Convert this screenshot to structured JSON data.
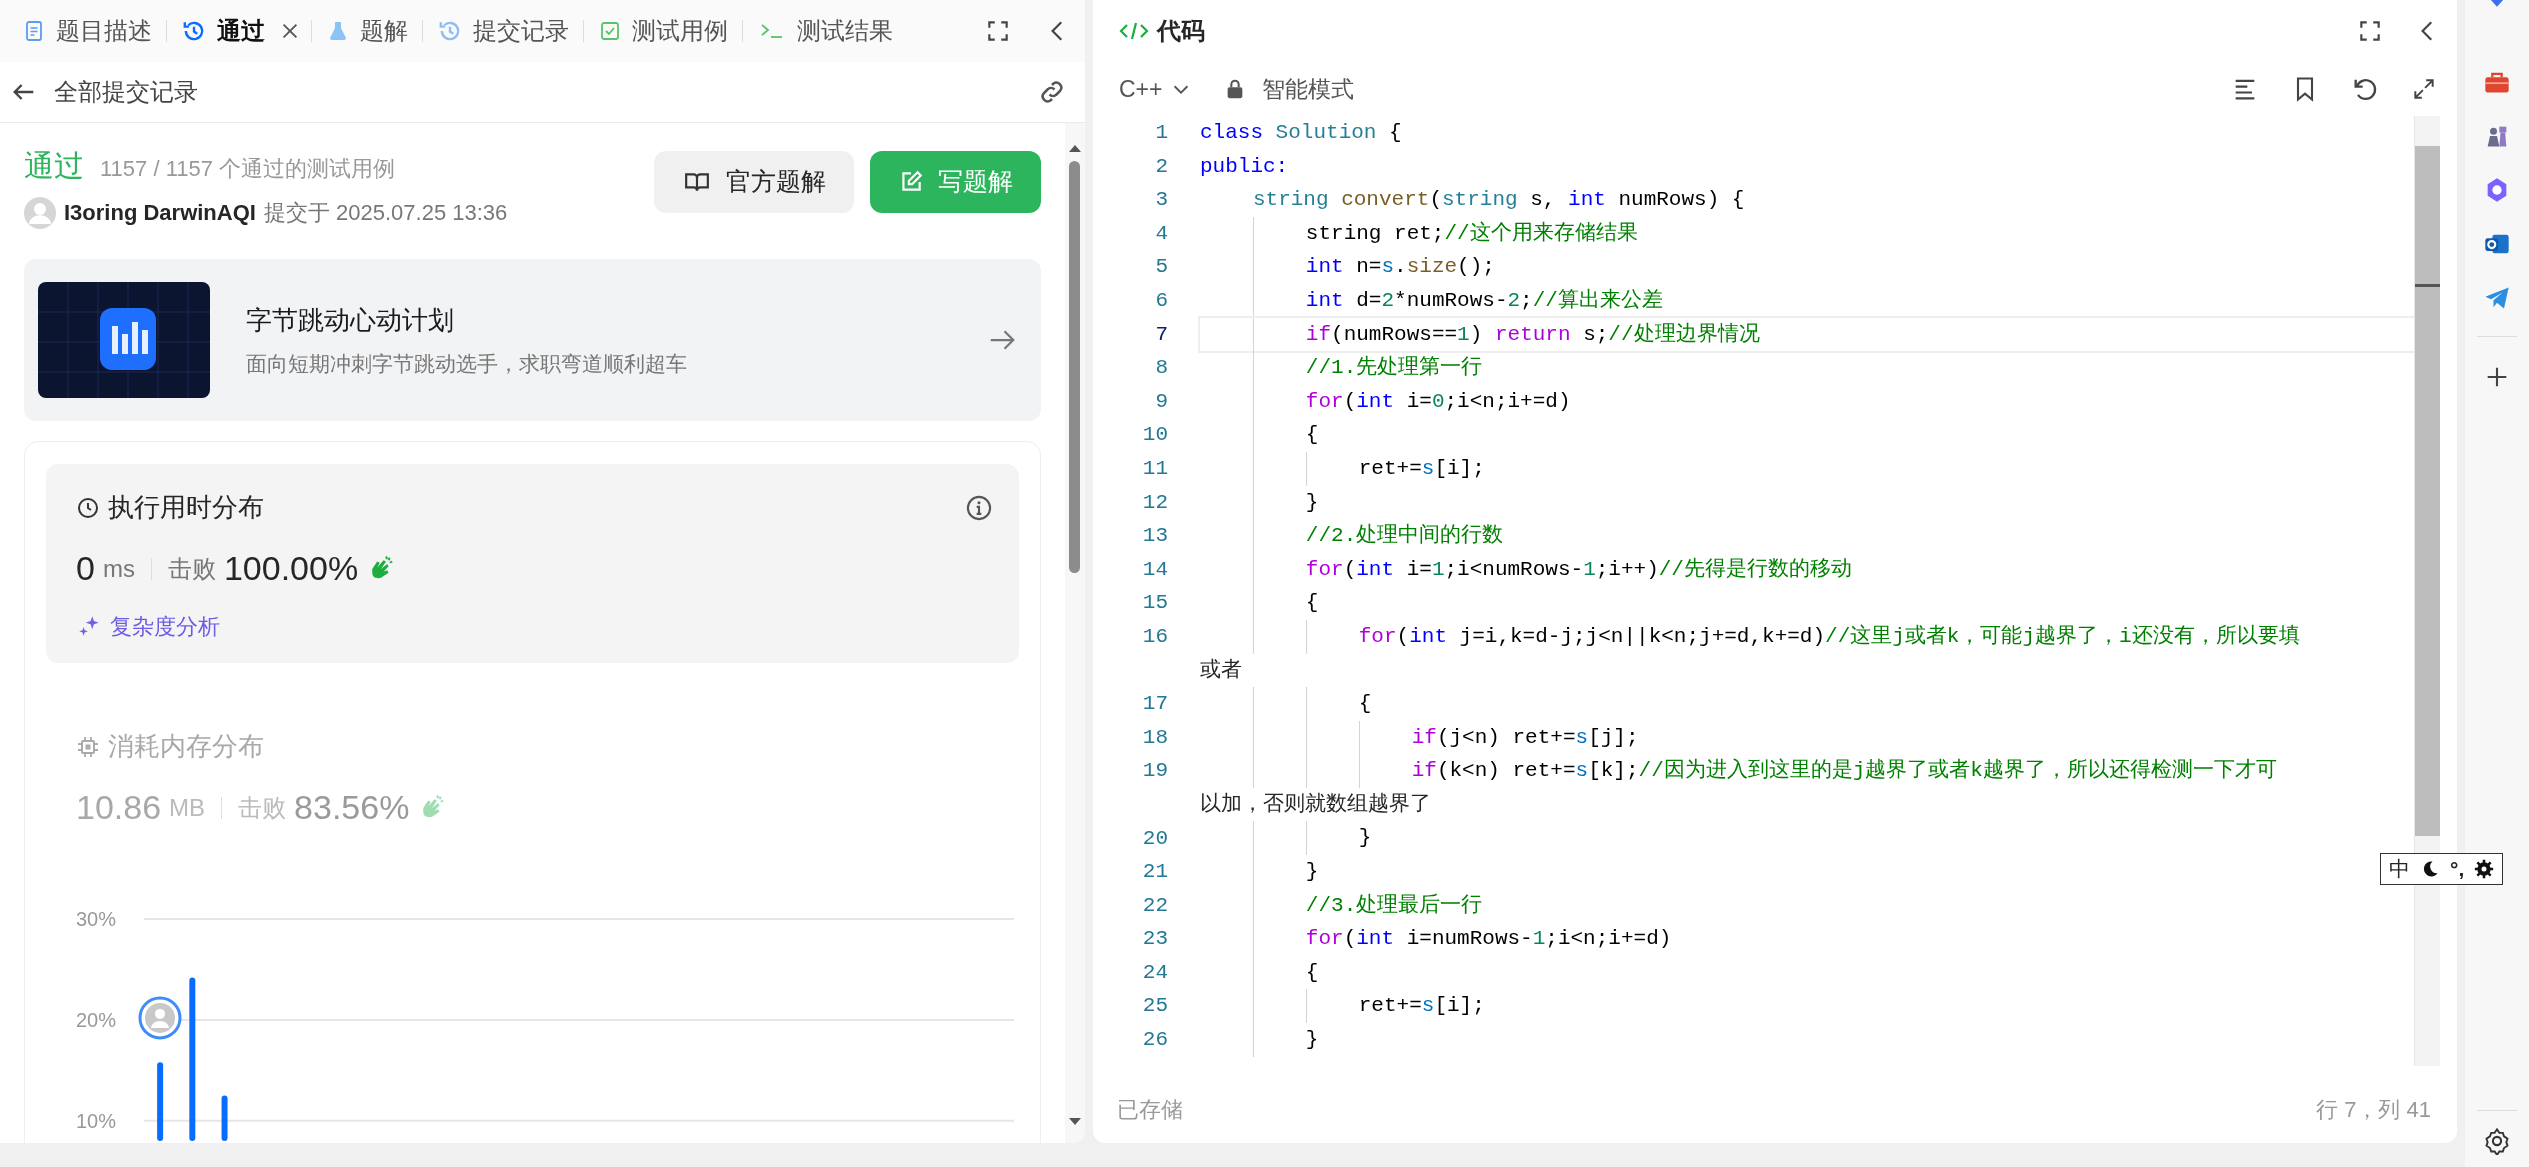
{
  "left_tabs": [
    {
      "label": "题目描述",
      "selected": false,
      "closable": false
    },
    {
      "label": "通过",
      "selected": true,
      "closable": true
    },
    {
      "label": "题解",
      "selected": false,
      "closable": false
    },
    {
      "label": "提交记录",
      "selected": false,
      "closable": false
    },
    {
      "label": "测试用例",
      "selected": false,
      "closable": false
    },
    {
      "label": "测试结果",
      "selected": false,
      "closable": false
    }
  ],
  "back_link": "全部提交记录",
  "result": {
    "status": "通过",
    "cases": "1157 / 1157 个通过的测试用例",
    "user": "I3oring DarwinAQI",
    "submitted": "提交于 2025.07.25 13:36"
  },
  "buttons": [
    {
      "label": "官方题解",
      "kind": "secondary"
    },
    {
      "label": "写题解",
      "kind": "primary"
    }
  ],
  "banner": {
    "title": "字节跳动心动计划",
    "subtitle": "面向短期冲刺字节跳动选手，求职弯道顺利超车"
  },
  "metrics": [
    {
      "title": "执行用时分布",
      "value": "0",
      "unit": "ms",
      "beats_label": "击败",
      "beats": "100.00%",
      "selected": true,
      "link": "复杂度分析"
    },
    {
      "title": "消耗内存分布",
      "value": "10.86",
      "unit": "MB",
      "beats_label": "击败",
      "beats": "83.56%",
      "selected": false
    }
  ],
  "chart_data": {
    "type": "bar",
    "values": [
      15.8,
      24.2,
      12.5,
      null,
      null,
      null,
      null,
      null,
      null,
      null,
      null,
      null,
      null,
      null,
      null,
      null,
      null,
      null,
      null,
      null,
      null,
      null,
      null,
      null,
      null,
      null,
      null
    ],
    "ylim": [
      8,
      30
    ],
    "yticks": [
      {
        "value": 10,
        "label": "10%"
      },
      {
        "value": 20,
        "label": "20%"
      },
      {
        "value": 30,
        "label": "30%"
      }
    ]
  },
  "editor": {
    "title": "代码",
    "language": "C++",
    "mode": "智能模式",
    "lines": [
      {
        "number": "1",
        "current": false,
        "tokens": [
          {
            "kind": "keyword",
            "text": "class"
          },
          {
            "kind": "type",
            "text": " Solution"
          },
          {
            "kind": "plain",
            "text": " {"
          }
        ]
      },
      {
        "number": "2",
        "current": false,
        "tokens": [
          {
            "kind": "keyword",
            "text": "public:"
          }
        ]
      },
      {
        "number": "3",
        "current": false,
        "tokens": [
          {
            "kind": "type",
            "text": "    string"
          },
          {
            "kind": "function",
            "text": " convert"
          },
          {
            "kind": "plain",
            "text": "("
          },
          {
            "kind": "type",
            "text": "string"
          },
          {
            "kind": "plain",
            "text": " s, "
          },
          {
            "kind": "keyword",
            "text": "int"
          },
          {
            "kind": "plain",
            "text": " numRows) {"
          }
        ]
      },
      {
        "number": "4",
        "current": false,
        "tokens": [
          {
            "kind": "plain",
            "text": "        string ret;"
          },
          {
            "kind": "comment",
            "text": "//这个用来存储结果"
          }
        ]
      },
      {
        "number": "5",
        "current": false,
        "tokens": [
          {
            "kind": "keyword",
            "text": "        int"
          },
          {
            "kind": "plain",
            "text": " n="
          },
          {
            "kind": "variable",
            "text": "s"
          },
          {
            "kind": "plain",
            "text": "."
          },
          {
            "kind": "function",
            "text": "size"
          },
          {
            "kind": "plain",
            "text": "();"
          }
        ]
      },
      {
        "number": "6",
        "current": false,
        "tokens": [
          {
            "kind": "keyword",
            "text": "        int"
          },
          {
            "kind": "plain",
            "text": " d="
          },
          {
            "kind": "number",
            "text": "2"
          },
          {
            "kind": "plain",
            "text": "*numRows-"
          },
          {
            "kind": "number",
            "text": "2"
          },
          {
            "kind": "plain",
            "text": ";"
          },
          {
            "kind": "comment",
            "text": "//算出来公差"
          }
        ]
      },
      {
        "number": "7",
        "current": true,
        "tokens": [
          {
            "kind": "control",
            "text": "        if"
          },
          {
            "kind": "plain",
            "text": "(numRows=="
          },
          {
            "kind": "number",
            "text": "1"
          },
          {
            "kind": "plain",
            "text": ") "
          },
          {
            "kind": "control",
            "text": "return"
          },
          {
            "kind": "plain",
            "text": " s;"
          },
          {
            "kind": "comment",
            "text": "//处理边界情况"
          }
        ]
      },
      {
        "number": "8",
        "current": false,
        "tokens": [
          {
            "kind": "comment",
            "text": "        //1.先处理第一行"
          }
        ]
      },
      {
        "number": "9",
        "current": false,
        "tokens": [
          {
            "kind": "control",
            "text": "        for"
          },
          {
            "kind": "plain",
            "text": "("
          },
          {
            "kind": "keyword",
            "text": "int"
          },
          {
            "kind": "plain",
            "text": " i="
          },
          {
            "kind": "number",
            "text": "0"
          },
          {
            "kind": "plain",
            "text": ";i<n;i+=d)"
          }
        ]
      },
      {
        "number": "10",
        "current": false,
        "tokens": [
          {
            "kind": "plain",
            "text": "        {"
          }
        ]
      },
      {
        "number": "11",
        "current": false,
        "tokens": [
          {
            "kind": "plain",
            "text": "            ret+="
          },
          {
            "kind": "variable",
            "text": "s"
          },
          {
            "kind": "plain",
            "text": "[i];"
          }
        ]
      },
      {
        "number": "12",
        "current": false,
        "tokens": [
          {
            "kind": "plain",
            "text": "        }"
          }
        ]
      },
      {
        "number": "13",
        "current": false,
        "tokens": [
          {
            "kind": "comment",
            "text": "        //2.处理中间的行数"
          }
        ]
      },
      {
        "number": "14",
        "current": false,
        "tokens": [
          {
            "kind": "control",
            "text": "        for"
          },
          {
            "kind": "plain",
            "text": "("
          },
          {
            "kind": "keyword",
            "text": "int"
          },
          {
            "kind": "plain",
            "text": " i="
          },
          {
            "kind": "number",
            "text": "1"
          },
          {
            "kind": "plain",
            "text": ";i<numRows-"
          },
          {
            "kind": "number",
            "text": "1"
          },
          {
            "kind": "plain",
            "text": ";i++)"
          },
          {
            "kind": "comment",
            "text": "//先得是行数的移动"
          }
        ]
      },
      {
        "number": "15",
        "current": false,
        "tokens": [
          {
            "kind": "plain",
            "text": "        {"
          }
        ]
      },
      {
        "number": "16",
        "current": false,
        "tokens": [
          {
            "kind": "control",
            "text": "            for"
          },
          {
            "kind": "plain",
            "text": "("
          },
          {
            "kind": "keyword",
            "text": "int"
          },
          {
            "kind": "plain",
            "text": " j=i,k=d-j;j<n||k<n;j+=d,k+=d)"
          },
          {
            "kind": "comment",
            "text": "//这里j或者k，可能j越界了，i还没有，所以要填"
          }
        ],
        "continuation": "或者"
      },
      {
        "number": "17",
        "current": false,
        "tokens": [
          {
            "kind": "plain",
            "text": "            {"
          }
        ]
      },
      {
        "number": "18",
        "current": false,
        "tokens": [
          {
            "kind": "control",
            "text": "                if"
          },
          {
            "kind": "plain",
            "text": "(j<n) ret+="
          },
          {
            "kind": "variable",
            "text": "s"
          },
          {
            "kind": "plain",
            "text": "[j];"
          }
        ]
      },
      {
        "number": "19",
        "current": false,
        "tokens": [
          {
            "kind": "control",
            "text": "                if"
          },
          {
            "kind": "plain",
            "text": "(k<n) ret+="
          },
          {
            "kind": "variable",
            "text": "s"
          },
          {
            "kind": "plain",
            "text": "[k];"
          },
          {
            "kind": "comment",
            "text": "//因为进入到这里的是j越界了或者k越界了，所以还得检测一下才可"
          }
        ],
        "continuation": "以加，否则就数组越界了"
      },
      {
        "number": "20",
        "current": false,
        "tokens": [
          {
            "kind": "plain",
            "text": "            }"
          }
        ]
      },
      {
        "number": "21",
        "current": false,
        "tokens": [
          {
            "kind": "plain",
            "text": "        }"
          }
        ]
      },
      {
        "number": "22",
        "current": false,
        "tokens": [
          {
            "kind": "comment",
            "text": "        //3.处理最后一行"
          }
        ]
      },
      {
        "number": "23",
        "current": false,
        "tokens": [
          {
            "kind": "control",
            "text": "        for"
          },
          {
            "kind": "plain",
            "text": "("
          },
          {
            "kind": "keyword",
            "text": "int"
          },
          {
            "kind": "plain",
            "text": " i=numRows-"
          },
          {
            "kind": "number",
            "text": "1"
          },
          {
            "kind": "plain",
            "text": ";i<n;i+=d)"
          }
        ]
      },
      {
        "number": "24",
        "current": false,
        "tokens": [
          {
            "kind": "plain",
            "text": "        {"
          }
        ]
      },
      {
        "number": "25",
        "current": false,
        "tokens": [
          {
            "kind": "plain",
            "text": "            ret+="
          },
          {
            "kind": "variable",
            "text": "s"
          },
          {
            "kind": "plain",
            "text": "[i];"
          }
        ]
      },
      {
        "number": "26",
        "current": false,
        "tokens": [
          {
            "kind": "plain",
            "text": "        }"
          }
        ]
      }
    ]
  },
  "status_bar": {
    "saved": "已存储",
    "position": "行 7，列 41"
  },
  "ime_toolbar": {
    "mode": "中",
    "punctuation": "°,"
  }
}
